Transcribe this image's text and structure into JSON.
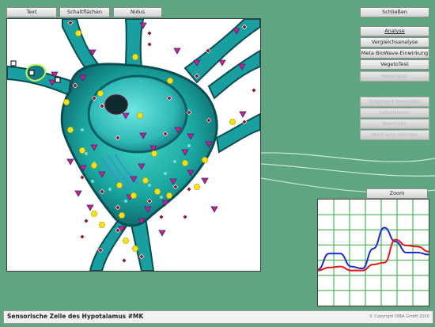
{
  "top_tabs": [
    {
      "label": "Text"
    },
    {
      "label": "Schaltflächen"
    },
    {
      "label": "Nidus"
    }
  ],
  "right_buttons": {
    "close": "Schließen",
    "analysis": "Analyse",
    "comparative": "Vergleichsanalyse",
    "bioware": "Meta BioWave-Einwirkung",
    "vegeto": "VegetoTest",
    "repair": "Reparatur",
    "fragments": "Fragment bewerten",
    "localize": "Lokalisieren",
    "evaluate": "Bewerten",
    "delete_marks": "Markierte löschen"
  },
  "zoom_label": "Zoom",
  "footer": {
    "title": "Sensorische Zelle des Hypotalamus #MK",
    "copyright": "© Copyright DIBA GmbH 2010"
  },
  "colors": {
    "background": "#5fa57f",
    "cell": "#1fb9b0",
    "marker_triangle": "#d81f6e",
    "marker_hexagon": "#f4e117",
    "marker_diamond": "#8b1b2c",
    "graph_grid": "#2fa83a",
    "series_blue": "#1b2bd1",
    "series_red": "#e01818"
  },
  "chart_data": {
    "type": "line",
    "x": [
      0,
      1,
      2,
      3,
      4,
      5,
      6,
      7,
      8,
      9,
      10
    ],
    "series": [
      {
        "values": [
          33,
          49,
          49,
          36,
          34,
          54,
          75,
          61,
          50,
          50,
          48
        ]
      },
      {
        "values": [
          32,
          35,
          36,
          32,
          32,
          38,
          40,
          63,
          57,
          56,
          51
        ]
      }
    ],
    "ylim": [
      0,
      100
    ]
  }
}
